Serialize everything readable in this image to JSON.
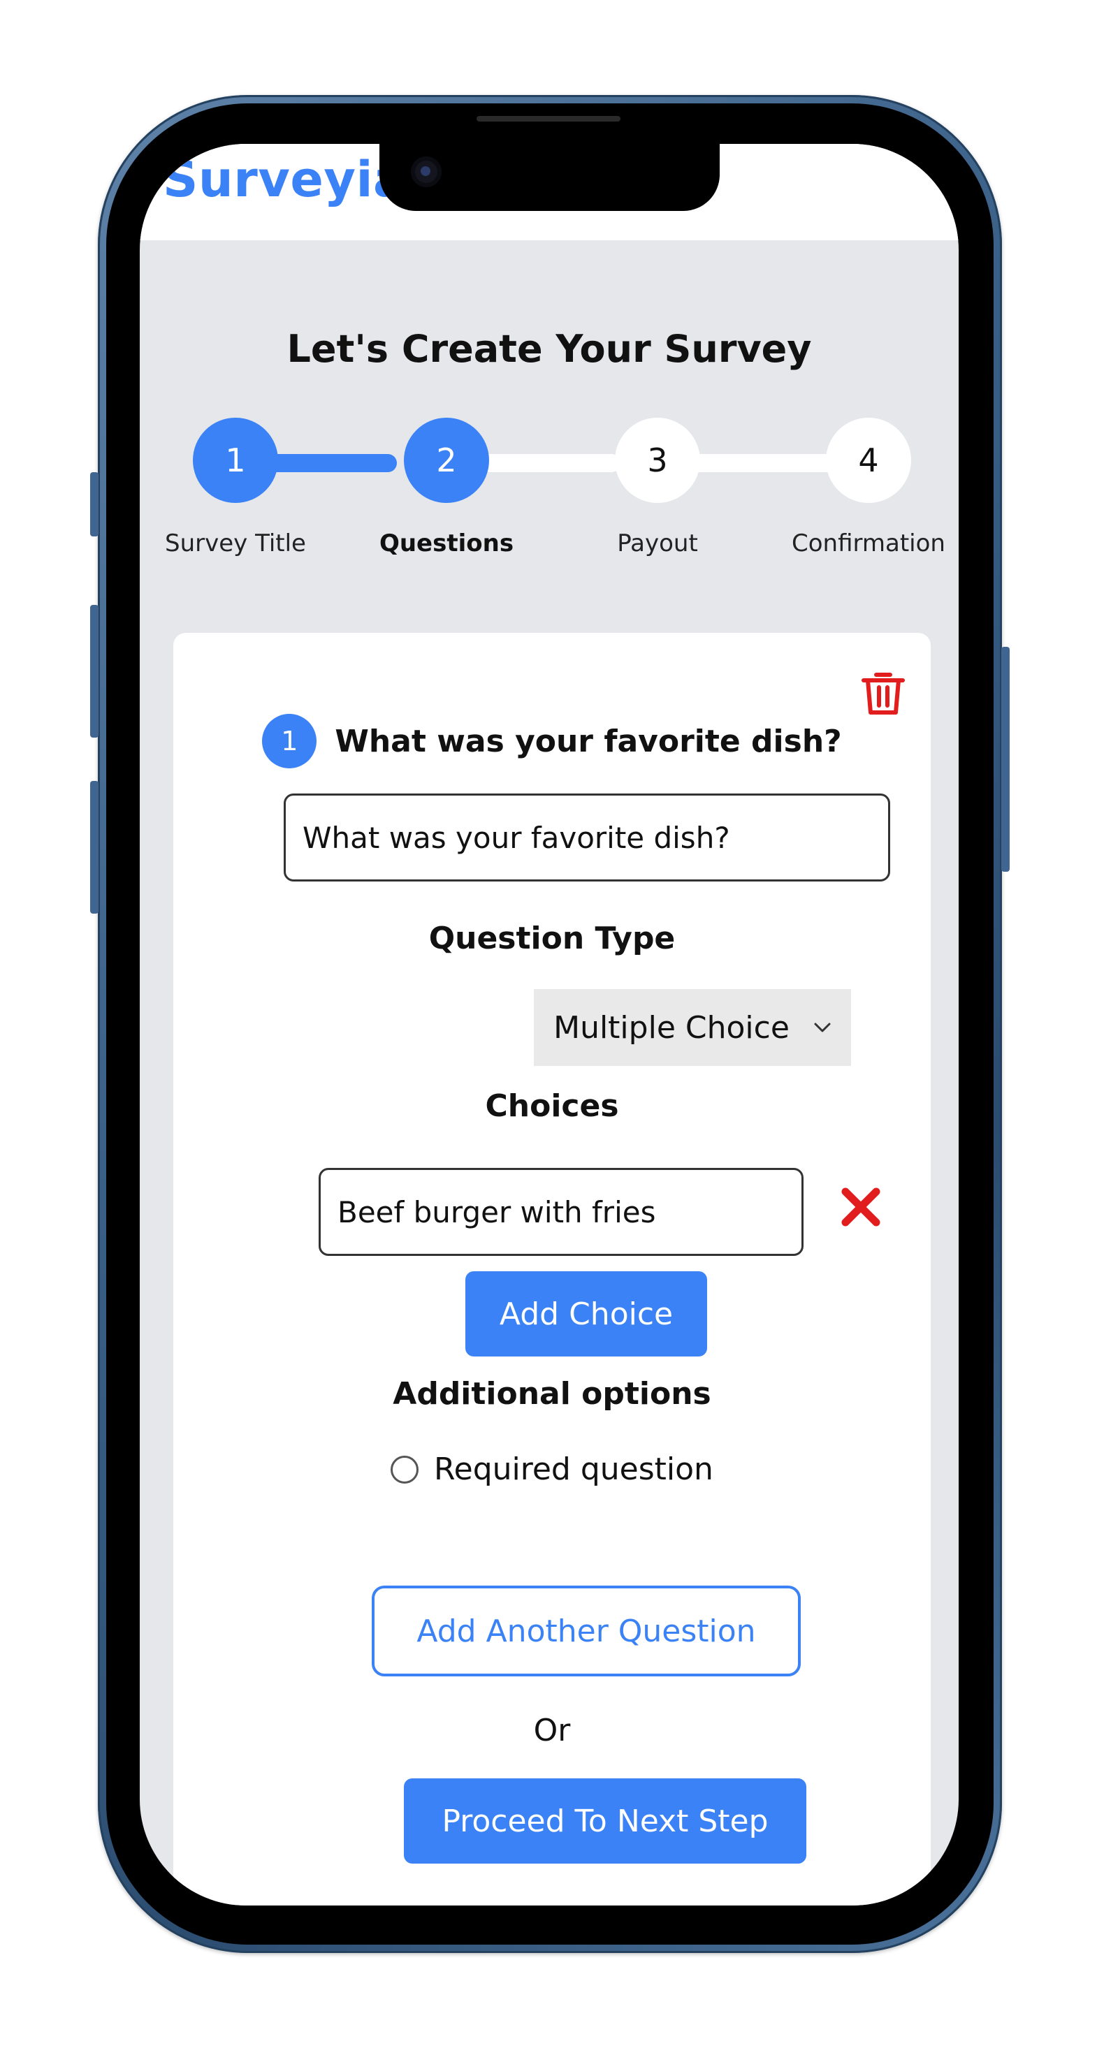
{
  "app": {
    "brand": "Surveyia"
  },
  "page": {
    "title": "Let's Create Your Survey"
  },
  "stepper": {
    "steps": [
      {
        "number": "1",
        "label": "Survey Title",
        "state": "complete"
      },
      {
        "number": "2",
        "label": "Questions",
        "state": "current"
      },
      {
        "number": "3",
        "label": "Payout",
        "state": "upcoming"
      },
      {
        "number": "4",
        "label": "Confirmation",
        "state": "upcoming"
      }
    ]
  },
  "question": {
    "number": "1",
    "title": "What was your favorite dish?",
    "input_value": "What was your favorite dish?",
    "type_label": "Question Type",
    "type_value": "Multiple Choice",
    "choices_label": "Choices",
    "choices": [
      {
        "value": "Beef burger with fries"
      }
    ],
    "add_choice_label": "Add Choice",
    "options_label": "Additional options",
    "required_label": "Required question",
    "required_checked": false
  },
  "actions": {
    "add_question_label": "Add Another Question",
    "or_text": "Or",
    "proceed_label": "Proceed To Next Step"
  },
  "icons": {
    "delete": "trash-icon",
    "remove_choice": "close-icon",
    "select": "chevron-down-icon"
  },
  "colors": {
    "accent": "#3b82f6",
    "danger": "#e11d1d",
    "background": "#e5e7eb",
    "card": "#ffffff",
    "device_frame": "#3a5f86"
  }
}
